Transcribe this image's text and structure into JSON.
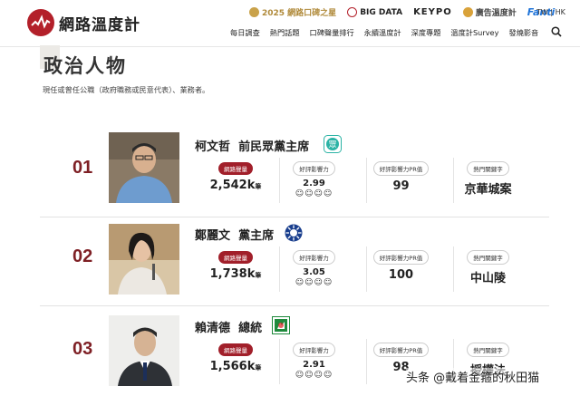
{
  "brand": {
    "name": "網路溫度計"
  },
  "partners": [
    {
      "label": "2025 網路口碑之星",
      "icon": "award-icon",
      "color": "#b08a3a"
    },
    {
      "label": "BIG DATA",
      "icon": "bigdata-icon",
      "color": "#222222"
    },
    {
      "label": "KEYPO",
      "icon": "keypo-icon",
      "color": "#222222"
    },
    {
      "label": "廣告溫度計",
      "icon": "adthermo-icon",
      "color": "#c8902e"
    },
    {
      "label": "Fanti",
      "icon": "fanti-icon",
      "color": "#1e73d8"
    }
  ],
  "lang": "TW | HK",
  "nav": [
    "每日調查",
    "熱門話題",
    "口碑聲量排行",
    "永續溫度計",
    "深度專題",
    "溫度計Survey",
    "發燒影音"
  ],
  "page": {
    "title": "政治人物",
    "subtitle": "現任或曾任公職（政府職務或民意代表）、業務者。"
  },
  "metric_labels": {
    "volume": "網路聲量",
    "rating": "好評影響力",
    "pr": "好評影響力PR值",
    "keyword": "熱門關鍵字"
  },
  "volume_unit": "筆",
  "rows": [
    {
      "rank": "01",
      "name": "柯文哲",
      "title": "前民眾黨主席",
      "party_icon": "tpp-icon",
      "volume": "2,542k",
      "rating": "2.99",
      "pr": "99",
      "keyword": "京華城案"
    },
    {
      "rank": "02",
      "name": "鄭麗文",
      "title": "黨主席",
      "party_icon": "kmt-icon",
      "volume": "1,738k",
      "rating": "3.05",
      "pr": "100",
      "keyword": "中山陵"
    },
    {
      "rank": "03",
      "name": "賴清德",
      "title": "總統",
      "party_icon": "dpp-icon",
      "volume": "1,566k",
      "rating": "2.91",
      "pr": "98",
      "keyword": "授權法"
    }
  ],
  "watermark": "头条 @戴着金箍的秋田猫",
  "colors": {
    "brand_red": "#b3202a",
    "rank_red": "#7e1f24",
    "tpp": "#2bb3a5",
    "kmt": "#1a3f8e",
    "dpp": "#1f8a3c"
  }
}
